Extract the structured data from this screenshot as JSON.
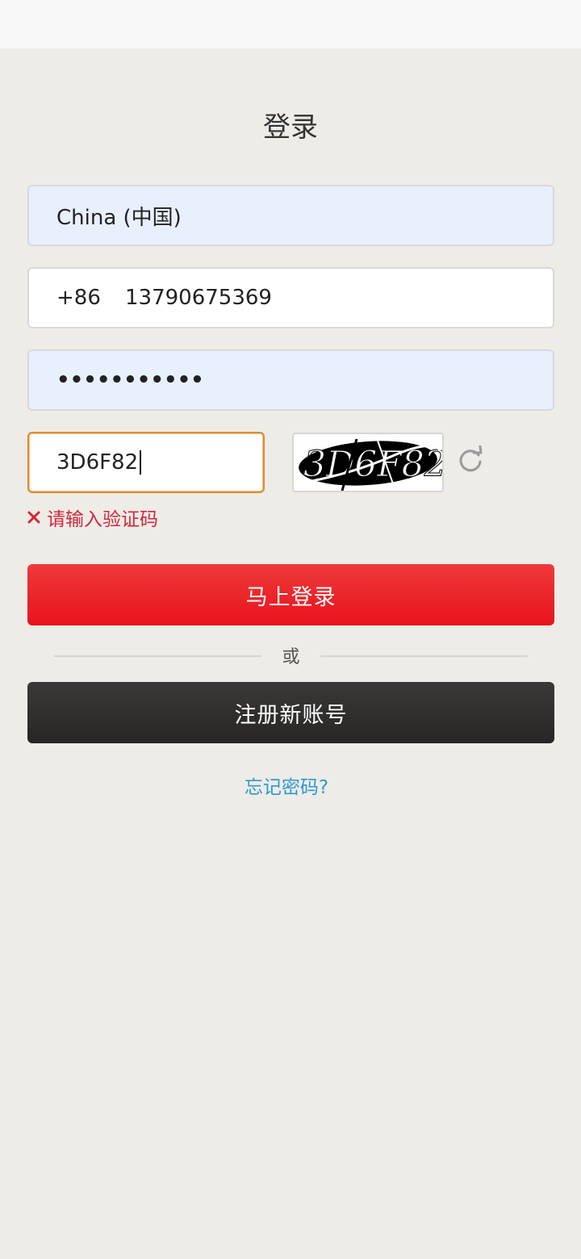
{
  "page": {
    "title": "登录"
  },
  "form": {
    "country": {
      "value": "China (中国)"
    },
    "phone": {
      "prefix": "+86",
      "value": "13790675369"
    },
    "password": {
      "masked_value": "•••••••••••"
    },
    "captcha": {
      "value": "3D6F82",
      "image_text": "3D6F82",
      "error": "请输入验证码"
    }
  },
  "actions": {
    "login_label": "马上登录",
    "or_label": "或",
    "register_label": "注册新账号",
    "forgot_label": "忘记密码?"
  },
  "colors": {
    "primary_red": "#e8131d",
    "dark_button": "#2a2927",
    "link_blue": "#2c9ad1",
    "error_red": "#d3273d",
    "focus_border": "#e08a2c",
    "autofill_bg": "#e8f0fe"
  },
  "icons": {
    "refresh": "refresh-icon",
    "error": "close-icon"
  }
}
